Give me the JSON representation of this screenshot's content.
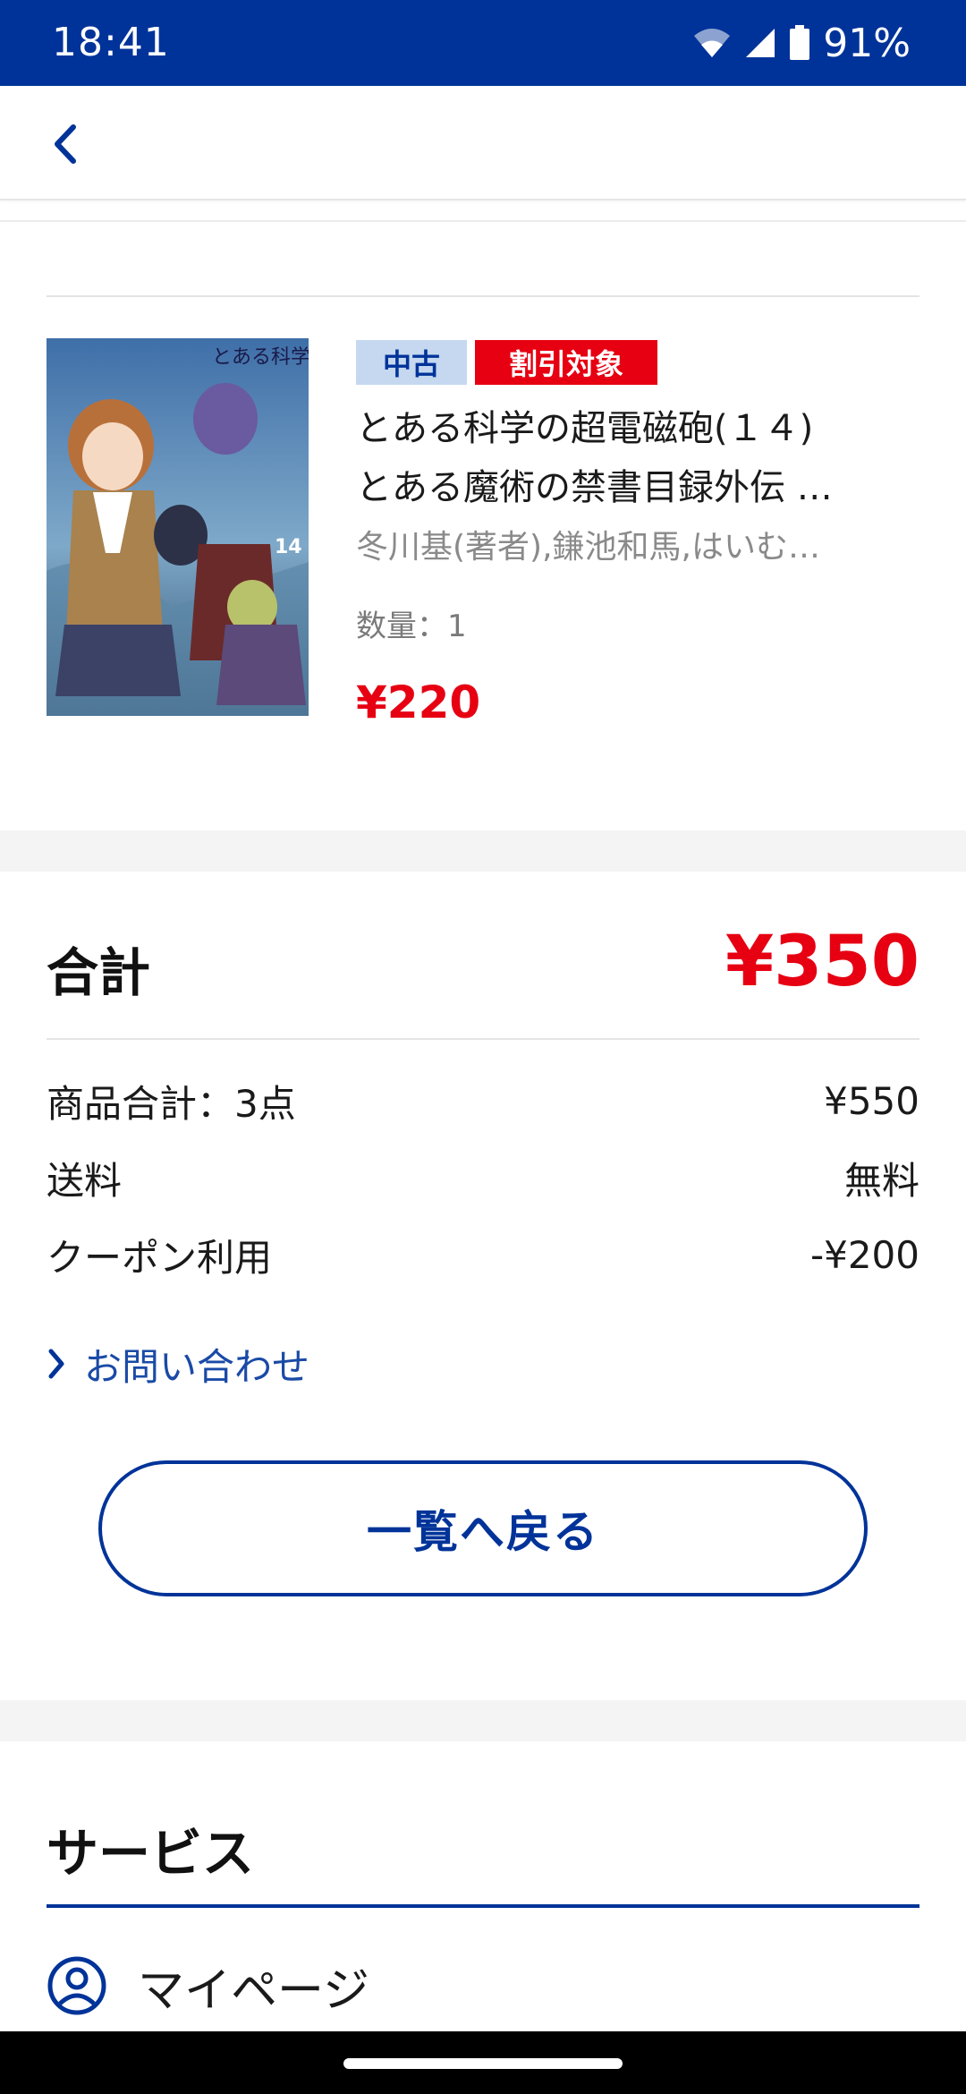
{
  "status_bar": {
    "time": "18:41",
    "battery": "91%",
    "background": "#003399"
  },
  "header": {
    "back_icon": "chevron-left-icon"
  },
  "item": {
    "badges": {
      "condition": "中古",
      "discount": "割引対象"
    },
    "title_line1": "とある科学の超電磁砲(１４)",
    "title_line2": "とある魔術の禁書目録外伝 …",
    "author": "冬川基(著者),鎌池和馬,はいむ…",
    "quantity": "数量：1",
    "price": "¥220",
    "cover_text": "とある科学の超電磁砲",
    "cover_volume": "14"
  },
  "summary": {
    "total_label": "合計",
    "total_value": "¥350",
    "rows": [
      {
        "label": "商品合計：3点",
        "value": "¥550"
      },
      {
        "label": "送料",
        "value": "無料"
      },
      {
        "label": "クーポン利用",
        "value": "-¥200"
      }
    ]
  },
  "contact_link": "お問い合わせ",
  "back_to_list_button": "一覧へ戻る",
  "services": {
    "title": "サービス",
    "mypage": "マイページ"
  },
  "colors": {
    "brand": "#003399",
    "price_red": "#e60012",
    "link": "#1a4aa6",
    "badge_used_bg": "#c5d8f0"
  }
}
